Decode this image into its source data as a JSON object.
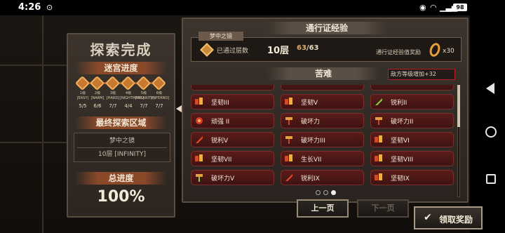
{
  "status_bar": {
    "time": "4:26",
    "battery": "98"
  },
  "left_panel": {
    "title": "探索完成",
    "maze_progress_label": "迷宫进度",
    "stages": [
      {
        "name": "1级[EASY]",
        "count": "5/5"
      },
      {
        "name": "2级[NARM]",
        "count": "6/6"
      },
      {
        "name": "3级[HARD]",
        "count": "7/7"
      },
      {
        "name": "4级[NIGHTMARE]",
        "count": "4/4"
      },
      {
        "name": "5级[INSANITY]",
        "count": "7/7"
      },
      {
        "name": "6级[INFERNO]",
        "count": "7/7"
      }
    ],
    "final_zone_label": "最终探索区域",
    "final_zone_name": "梦中之镜",
    "final_zone_floor": "10层 [INFINITY]",
    "total_progress_label": "总进度",
    "total_progress_value": "100%"
  },
  "right_panel": {
    "pass_exp_header": "通行证经验",
    "zone_tag": "梦中之镜",
    "cleared_label": "已通过层数",
    "floor_value": "10层",
    "floor_count": "63",
    "floor_total": "/63",
    "exp_reward_label": "通行证经验值奖励",
    "exp_multiplier": "x30",
    "hardship_header": "苦难",
    "enemy_bonus": "敌方等级增加+32",
    "hardships": [
      {
        "name": "坚韧III",
        "icon": "shield-up-icon"
      },
      {
        "name": "坚韧V",
        "icon": "shield-up-icon"
      },
      {
        "name": "锐利II",
        "icon": "blade-icon"
      },
      {
        "name": "顽强 II",
        "icon": "fire-heart-icon"
      },
      {
        "name": "破坏力",
        "icon": "hammer-icon"
      },
      {
        "name": "破坏力II",
        "icon": "hammer-icon"
      },
      {
        "name": "锐利V",
        "icon": "blade-icon"
      },
      {
        "name": "破坏力III",
        "icon": "hammer-icon"
      },
      {
        "name": "坚韧VI",
        "icon": "shield-up-icon"
      },
      {
        "name": "坚韧VII",
        "icon": "shield-up-icon"
      },
      {
        "name": "生长VII",
        "icon": "shield-up-icon"
      },
      {
        "name": "坚韧VIII",
        "icon": "shield-up-icon"
      },
      {
        "name": "破坏力V",
        "icon": "hammer-icon"
      },
      {
        "name": "锐利IX",
        "icon": "blade-icon"
      },
      {
        "name": "坚韧IX",
        "icon": "shield-up-icon"
      }
    ],
    "page_count": 3,
    "current_page": 3
  },
  "buttons": {
    "prev": "上一页",
    "next": "下一页",
    "claim": "领取奖励"
  },
  "colors": {
    "accent": "#c7792f",
    "hardship_bg": "#5a1c1a",
    "bonus_border": "#b32020"
  }
}
